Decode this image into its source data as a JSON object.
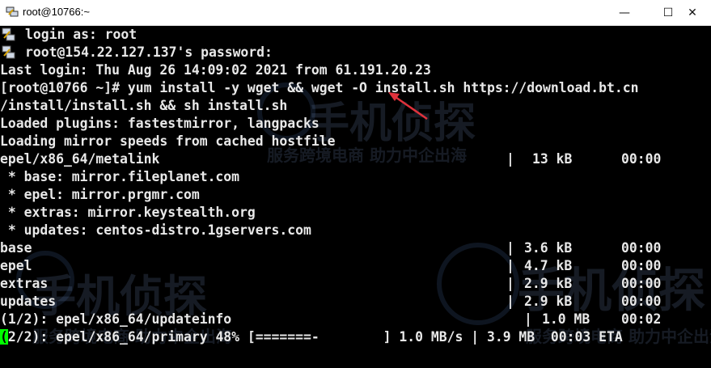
{
  "window": {
    "title": "root@10766:~"
  },
  "controls": {
    "minimize": "—",
    "maximize": "☐",
    "close": "✕"
  },
  "terminal": {
    "lines": [
      "login as: root",
      "root@154.22.127.137's password:",
      "Last login: Thu Aug 26 14:09:02 2021 from 61.191.20.23",
      "[root@10766 ~]# yum install -y wget && wget -O install.sh https://download.bt.cn",
      "/install/install.sh && sh install.sh",
      "Loaded plugins: fastestmirror, langpacks",
      "Loading mirror speeds from cached hostfile",
      "epel/x86_64/metalink",
      " * base: mirror.fileplanet.com",
      " * epel: mirror.prgmr.com",
      " * extras: mirror.keystealth.org",
      " * updates: centos-distro.1gservers.com",
      "base",
      "epel",
      "extras",
      "updates",
      "(1/2): epel/x86_64/updateinfo",
      "(2/2): epel/x86_64/primary 48% [=======-        ] 1.0 MB/s | 3.9 MB  00:03 ETA"
    ],
    "status_cols": [
      {
        "row": 7,
        "sep": "|",
        "size": "13 kB",
        "time": "00:00"
      },
      {
        "row": 12,
        "sep": "|",
        "size": "3.6 kB",
        "time": "00:00"
      },
      {
        "row": 13,
        "sep": "|",
        "size": "4.7 kB",
        "time": "00:00"
      },
      {
        "row": 14,
        "sep": "|",
        "size": "2.9 kB",
        "time": "00:00"
      },
      {
        "row": 15,
        "sep": "|",
        "size": "2.9 kB",
        "time": "00:00"
      },
      {
        "row": 16,
        "sep": "|",
        "size": "1.0 MB",
        "time": "00:02"
      }
    ],
    "cursor_char": "(",
    "colors": {
      "foreground": "#e8e8e8",
      "background": "#000000",
      "cursor": "#00ff00",
      "arrow": "#e0323c"
    }
  },
  "watermark": {
    "brand": "手机侦探",
    "slogan": "服务跨境电商 助力中企出海",
    "slogan_partial": "服务跨境电商 助力中企出海"
  }
}
